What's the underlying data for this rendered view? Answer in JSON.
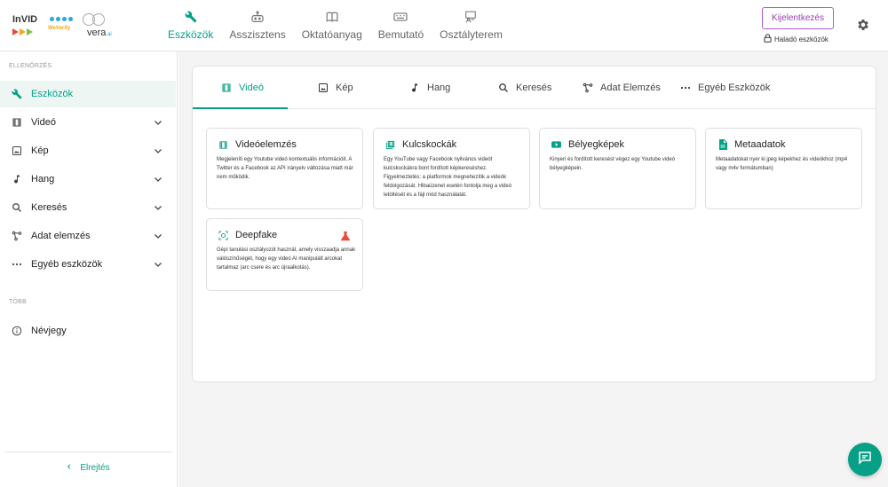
{
  "brand": {
    "invid": "InVID",
    "weverify": "WeVerify",
    "vera": "vera",
    "vera_suffix": ".ai"
  },
  "nav": {
    "items": [
      {
        "label": "Eszközök",
        "icon": "wrench-icon",
        "active": true
      },
      {
        "label": "Asszisztens",
        "icon": "robot-icon",
        "active": false
      },
      {
        "label": "Oktatóanyag",
        "icon": "book-icon",
        "active": false
      },
      {
        "label": "Bemutató",
        "icon": "keyboard-icon",
        "active": false
      },
      {
        "label": "Osztályterem",
        "icon": "classroom-icon",
        "active": false
      }
    ]
  },
  "header": {
    "login_label": "Kijelentkezés",
    "advanced_label": "Haladó eszközök"
  },
  "sidebar": {
    "section_check": "ELLENŐRZÉS",
    "section_more": "TÖBB",
    "items": [
      {
        "label": "Eszközök",
        "icon": "wrench-icon",
        "active": true,
        "expandable": false
      },
      {
        "label": "Videó",
        "icon": "film-icon",
        "active": false,
        "expandable": true
      },
      {
        "label": "Kép",
        "icon": "image-icon",
        "active": false,
        "expandable": true
      },
      {
        "label": "Hang",
        "icon": "music-note-icon",
        "active": false,
        "expandable": true
      },
      {
        "label": "Keresés",
        "icon": "search-icon",
        "active": false,
        "expandable": true
      },
      {
        "label": "Adat elemzés",
        "icon": "data-analysis-icon",
        "active": false,
        "expandable": true
      },
      {
        "label": "Egyéb eszközök",
        "icon": "more-dots-icon",
        "active": false,
        "expandable": true
      }
    ],
    "about_label": "Névjegy",
    "collapse_label": "Elrejtés"
  },
  "tabs": [
    {
      "label": "Videó",
      "icon": "film-icon",
      "active": true
    },
    {
      "label": "Kép",
      "icon": "image-icon",
      "active": false
    },
    {
      "label": "Hang",
      "icon": "music-note-icon",
      "active": false
    },
    {
      "label": "Keresés",
      "icon": "search-icon",
      "active": false
    },
    {
      "label": "Adat Elemzés",
      "icon": "data-analysis-icon",
      "active": false
    },
    {
      "label": "Egyéb Eszközök",
      "icon": "more-dots-icon",
      "active": false
    }
  ],
  "cards": [
    {
      "title": "Videóelemzés",
      "icon": "film-icon",
      "description": "Megjeleníti egy Youtube videó kontextuális információit. A Twitter és a Facebook az API irányelv változása miatt már nem működik."
    },
    {
      "title": "Kulcskockák",
      "icon": "keyframes-icon",
      "description": "Egy YouTube vagy Facebook nyilvános videót kulcskockákra bont fordított képkereséshez. Figyelmeztetés: a platformok megnehezítik a videók feldolgozását. Hibaüzenet esetén fontolja meg a videó letöltését és a fájl mód használatát."
    },
    {
      "title": "Bélyegképek",
      "icon": "youtube-icon",
      "description": "Kinyeri és fordított keresést végez egy Youtube videó bélyegképein."
    },
    {
      "title": "Metaadatok",
      "icon": "document-icon",
      "description": "Metaadatokat nyer ki jpeg képekhez és videókhoz (mp4 vagy m4v formátumban)"
    },
    {
      "title": "Deepfake",
      "icon": "deepfake-icon",
      "description": "Gépi tanulási osztályozót használ, amely visszaadja annak valószínűségét, hogy egy videó AI manipulált arcokat tartalmaz (arc csere és arc újraalkotás).",
      "experimental": true
    }
  ],
  "colors": {
    "accent": "#05a086",
    "login_border": "#b05cc9",
    "flask": "#e94b3c"
  }
}
